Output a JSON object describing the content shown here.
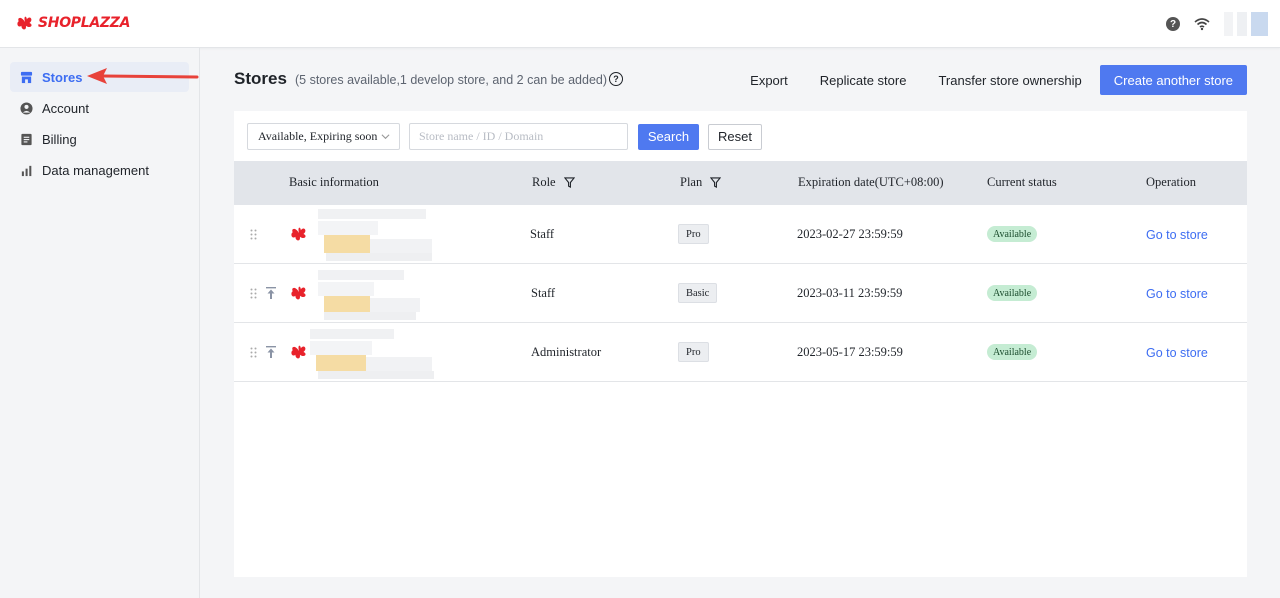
{
  "brand": {
    "name": "SHOPLAZZA",
    "color": "#e8222b"
  },
  "topbar": {
    "icons": [
      "help-icon",
      "wifi-icon",
      "avatar"
    ]
  },
  "sidebar": {
    "items": [
      {
        "label": "Stores",
        "icon": "store-icon",
        "active": true
      },
      {
        "label": "Account",
        "icon": "account-icon",
        "active": false
      },
      {
        "label": "Billing",
        "icon": "billing-icon",
        "active": false
      },
      {
        "label": "Data management",
        "icon": "chart-icon",
        "active": false
      }
    ]
  },
  "page": {
    "title": "Stores",
    "subtitle": "(5 stores available,1 develop store, and 2 can be added)",
    "actions": {
      "export": "Export",
      "replicate": "Replicate store",
      "transfer": "Transfer store ownership",
      "create": "Create another store"
    }
  },
  "filters": {
    "status_value": "Available, Expiring soon",
    "search_placeholder": "Store name / ID / Domain",
    "search_label": "Search",
    "reset_label": "Reset"
  },
  "table": {
    "columns": {
      "basic": "Basic information",
      "role": "Role",
      "plan": "Plan",
      "expiration": "Expiration date(UTC+08:00)",
      "status": "Current status",
      "operation": "Operation"
    },
    "rows": [
      {
        "role": "Staff",
        "plan": "Pro",
        "expiration": "2023-02-27 23:59:59",
        "status": "Available",
        "operation": "Go to store"
      },
      {
        "role": "Staff",
        "plan": "Basic",
        "expiration": "2023-03-11 23:59:59",
        "status": "Available",
        "operation": "Go to store"
      },
      {
        "role": "Administrator",
        "plan": "Pro",
        "expiration": "2023-05-17 23:59:59",
        "status": "Available",
        "operation": "Go to store"
      }
    ]
  },
  "colors": {
    "primary": "#4f79f0",
    "link": "#3d6df2",
    "status_available": "#c5ecd3",
    "annotation_arrow": "#e8423a"
  }
}
